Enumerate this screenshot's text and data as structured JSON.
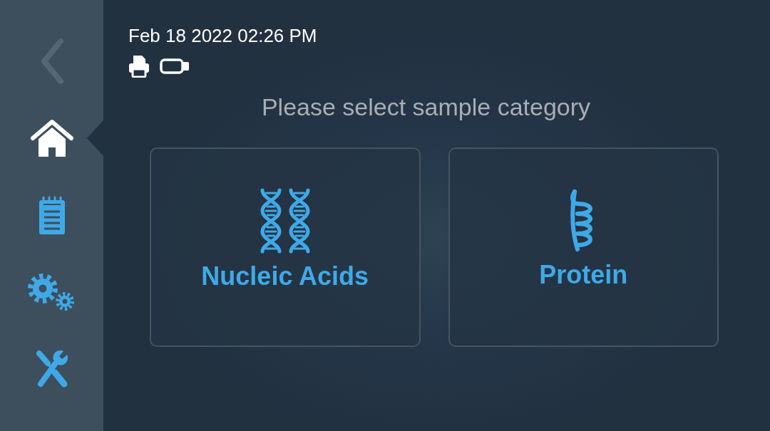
{
  "sidebar": {
    "back_button": {
      "disabled": true
    },
    "items": [
      {
        "selected": true
      },
      {
        "selected": false
      },
      {
        "selected": false
      },
      {
        "selected": false
      }
    ]
  },
  "status": {
    "datetime": "Feb 18 2022 02:26 PM"
  },
  "prompt": "Please select sample category",
  "categories": [
    {
      "label": "Nucleic Acids"
    },
    {
      "label": "Protein"
    }
  ]
}
